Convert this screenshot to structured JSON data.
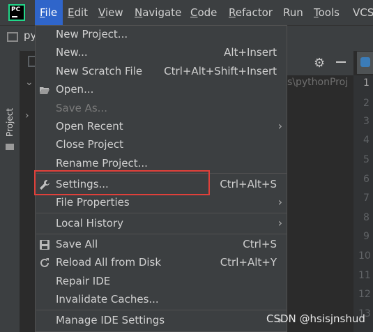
{
  "menubar": {
    "logo_text": "PC",
    "items": [
      {
        "label": "File",
        "underline": "F",
        "rest": "ile",
        "active": true
      },
      {
        "label": "Edit",
        "underline": "E",
        "rest": "dit"
      },
      {
        "label": "View",
        "underline": "V",
        "rest": "iew"
      },
      {
        "label": "Navigate",
        "underline": "N",
        "rest": "avigate"
      },
      {
        "label": "Code",
        "underline": "C",
        "rest": "ode"
      },
      {
        "label": "Refactor",
        "underline": "R",
        "rest": "efactor"
      },
      {
        "label": "Run",
        "underline": "",
        "rest": "Run"
      },
      {
        "label": "Tools",
        "underline": "T",
        "rest": "ools"
      },
      {
        "label": "VCS",
        "underline": "",
        "rest": "VCS"
      }
    ]
  },
  "project_fragment": "py",
  "left_strip_label": "Project",
  "editor": {
    "path_fragment": "s\\pythonProj",
    "line_numbers": [
      "1",
      "2",
      "3",
      "4",
      "5",
      "6",
      "7",
      "8",
      "9",
      "10",
      "11",
      "12",
      "13"
    ]
  },
  "file_menu": {
    "items": [
      {
        "label": "New Project...",
        "shortcut": ""
      },
      {
        "label": "New...",
        "shortcut": "Alt+Insert"
      },
      {
        "label": "New Scratch File",
        "shortcut": "Ctrl+Alt+Shift+Insert"
      },
      {
        "label": "Open...",
        "shortcut": ""
      },
      {
        "label": "Save As...",
        "shortcut": "",
        "disabled": true
      },
      {
        "label": "Open Recent",
        "shortcut": "",
        "submenu": true
      },
      {
        "label": "Close Project",
        "shortcut": ""
      },
      {
        "label": "Rename Project...",
        "shortcut": ""
      },
      {
        "label": "Settings...",
        "shortcut": "Ctrl+Alt+S"
      },
      {
        "label": "File Properties",
        "shortcut": "",
        "submenu": true
      },
      {
        "label": "Local History",
        "shortcut": "",
        "submenu": true
      },
      {
        "label": "Save All",
        "shortcut": "Ctrl+S"
      },
      {
        "label": "Reload All from Disk",
        "shortcut": "Ctrl+Alt+Y"
      },
      {
        "label": "Repair IDE",
        "shortcut": ""
      },
      {
        "label": "Invalidate Caches...",
        "shortcut": ""
      },
      {
        "label": "Manage IDE Settings",
        "shortcut": "",
        "submenu": true
      }
    ]
  },
  "watermark": "CSDN @hsisjnshud",
  "colors": {
    "menubar_bg": "#3c3f41",
    "active_menu": "#2f65ca",
    "highlight_border": "#e0403a",
    "editor_bg": "#2b2b2b"
  }
}
